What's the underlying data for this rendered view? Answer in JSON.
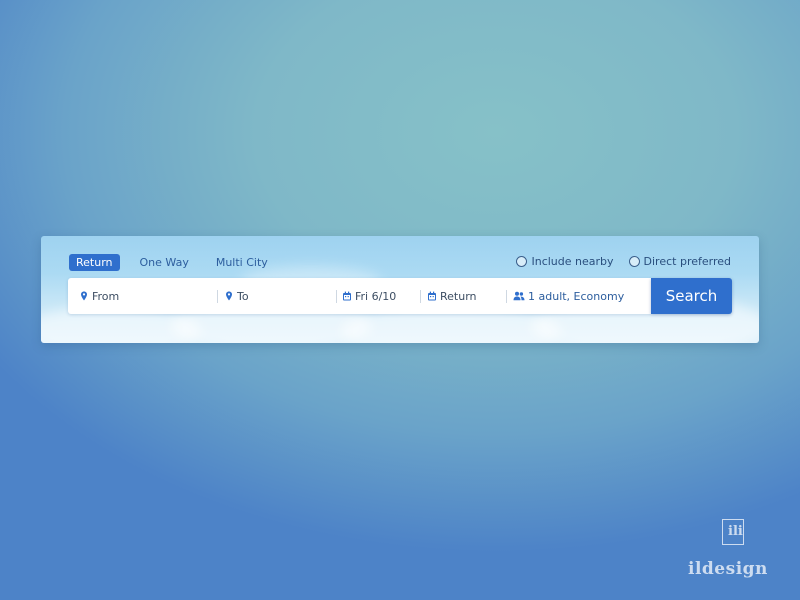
{
  "tabs": [
    {
      "label": "Return",
      "active": true
    },
    {
      "label": "One Way",
      "active": false
    },
    {
      "label": "Multi City",
      "active": false
    }
  ],
  "options": {
    "include_nearby": {
      "label": "Include nearby",
      "checked": false
    },
    "direct_preferred": {
      "label": "Direct preferred",
      "checked": false
    }
  },
  "fields": {
    "from": {
      "icon": "location-pin-icon",
      "placeholder": "From"
    },
    "to": {
      "icon": "location-pin-icon",
      "placeholder": "To"
    },
    "depart": {
      "icon": "calendar-icon",
      "value": "Fri 6/10"
    },
    "return": {
      "icon": "calendar-icon",
      "placeholder": "Return"
    },
    "passengers": {
      "icon": "people-icon",
      "value": "1 adult, Economy"
    }
  },
  "search_button": {
    "label": "Search"
  },
  "watermark": {
    "mark": "ili",
    "text": "ildesign"
  },
  "colors": {
    "accent": "#2f6fcd",
    "link": "#2d5e9e",
    "background": "#7fb8c8",
    "widget_sky": "#abdaf3"
  }
}
